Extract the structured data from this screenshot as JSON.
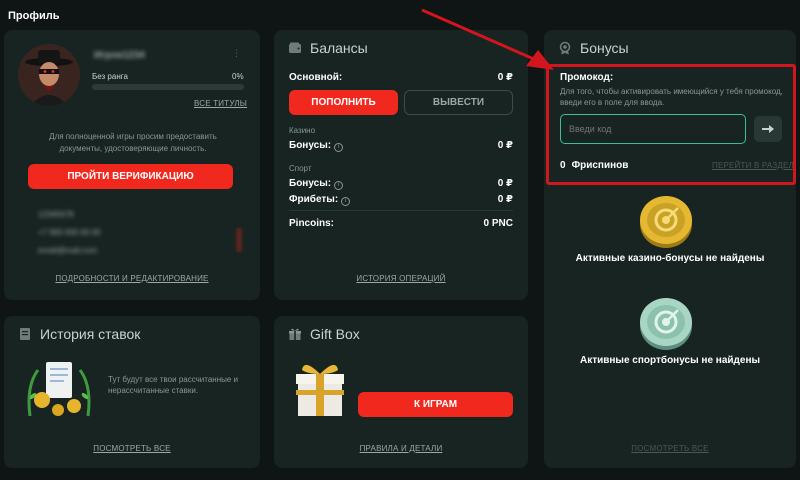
{
  "page": {
    "title": "Профиль"
  },
  "profile": {
    "username": "Игрок1234",
    "rank": "Без ранга",
    "rank_progress": "0%",
    "rank_progress_value": 0,
    "all_titles_link": "ВСЕ ТИТУЛЫ",
    "verify_message": "Для полноценной игры просим предоставить документы, удостоверяющие личность.",
    "verify_button": "ПРОЙТИ ВЕРИФИКАЦИЮ",
    "hidden_lines": [
      "12345678",
      "+7 900 000 00 00",
      "email@mail.com"
    ],
    "details_link": "ПОДРОБНОСТИ И РЕДАКТИРОВАНИЕ"
  },
  "balances": {
    "title": "Балансы",
    "main_label": "Основной:",
    "main_value": "0 ₽",
    "deposit_button": "ПОПОЛНИТЬ",
    "withdraw_button": "ВЫВЕСТИ",
    "casino_section": "Казино",
    "casino_bonus_label": "Бонусы:",
    "casino_bonus_value": "0 ₽",
    "sport_section": "Спорт",
    "sport_bonus_label": "Бонусы:",
    "sport_bonus_value": "0 ₽",
    "freebets_label": "Фрибеты:",
    "freebets_value": "0 ₽",
    "pincoins_label": "Pincoins:",
    "pincoins_value": "0 PNC",
    "history_link": "ИСТОРИЯ ОПЕРАЦИЙ"
  },
  "bonuses": {
    "title": "Бонусы",
    "promo_label": "Промокод:",
    "promo_hint": "Для того, чтобы активировать имеющийся у тебя промокод, введи его в поле для ввода.",
    "promo_placeholder": "Введи код",
    "freespins_count": "0",
    "freespins_label": "Фриспинов",
    "go_section_link": "ПЕРЕЙТИ В РАЗДЕЛ",
    "casino_empty": "Активные казино-бонусы не найдены",
    "sport_empty": "Активные спортбонусы не найдены",
    "view_all_link": "ПОСМОТРЕТЬ ВСЕ"
  },
  "bet_history": {
    "title": "История ставок",
    "message": "Тут будут все твои рассчитанные и нерассчитанные ставки.",
    "view_all_link": "ПОСМОТРЕТЬ ВСЕ"
  },
  "gift_box": {
    "title": "Gift Box",
    "games_button": "К ИГРАМ",
    "rules_link": "ПРАВИЛА И ДЕТАЛИ"
  },
  "colors": {
    "background": "#0e1514",
    "card": "#172421",
    "accent_red": "#f0281e",
    "annotation_red": "#d1161d"
  }
}
